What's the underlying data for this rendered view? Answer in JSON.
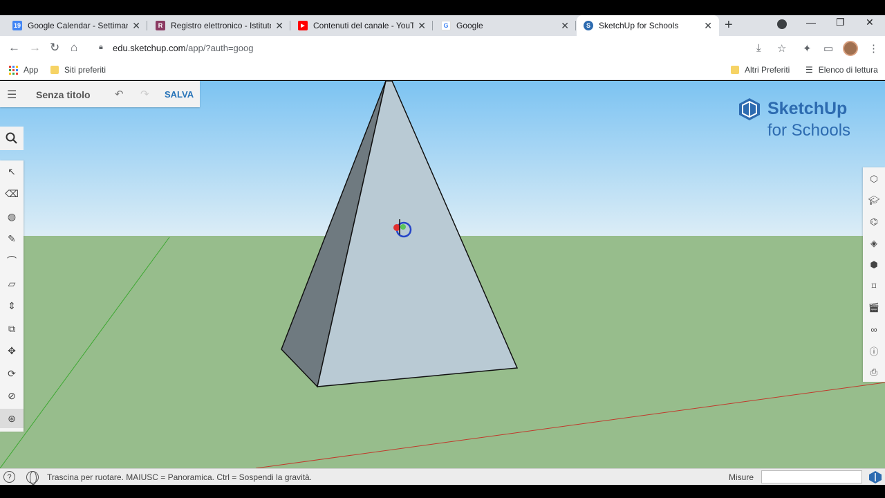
{
  "browser": {
    "tabs": [
      {
        "title": "Google Calendar - Settimana",
        "icon": "calendar-icon",
        "color": "#4285f4",
        "glyph": "19"
      },
      {
        "title": "Registro elettronico - Istituto",
        "icon": "school-crest-icon",
        "color": "#8b3a62",
        "glyph": "R"
      },
      {
        "title": "Contenuti del canale - YouTube",
        "icon": "youtube-icon",
        "color": "#ff0000",
        "glyph": "▶"
      },
      {
        "title": "Google",
        "icon": "google-icon",
        "color": "#4285f4",
        "glyph": "G"
      },
      {
        "title": "SketchUp for Schools",
        "icon": "sketchup-icon",
        "color": "#2d6bb0",
        "glyph": "S"
      }
    ],
    "url_host": "edu.sketchup.com",
    "url_path": "/app/?auth=goog",
    "bookmarks": {
      "apps_label": "App",
      "left": [
        "Siti preferiti"
      ],
      "other_label": "Altri Preferiti",
      "reading_list_label": "Elenco di lettura"
    }
  },
  "app": {
    "document_title": "Senza titolo",
    "save_label": "SALVA",
    "logo": {
      "line1": "SketchUp",
      "line2": "for Schools"
    },
    "left_tools": [
      "select",
      "eraser",
      "paint",
      "pencil",
      "arc",
      "rectangle",
      "push-pull",
      "offset",
      "move",
      "rotate",
      "tape-measure",
      "orbit"
    ],
    "active_tool": "orbit",
    "right_panel": [
      "entity-info",
      "instructor",
      "components",
      "materials",
      "styles",
      "tags",
      "scenes",
      "display",
      "info",
      "export"
    ]
  },
  "status": {
    "hint": "Trascina per ruotare. MAIUSC = Panoramica. Ctrl = Sospendi la gravità.",
    "measure_label": "Misure",
    "measure_value": ""
  },
  "colors": {
    "accent": "#2874b8",
    "sky_top": "#7cc3f2",
    "sky_bottom": "#dcedf6",
    "ground": "#97bd8c"
  }
}
